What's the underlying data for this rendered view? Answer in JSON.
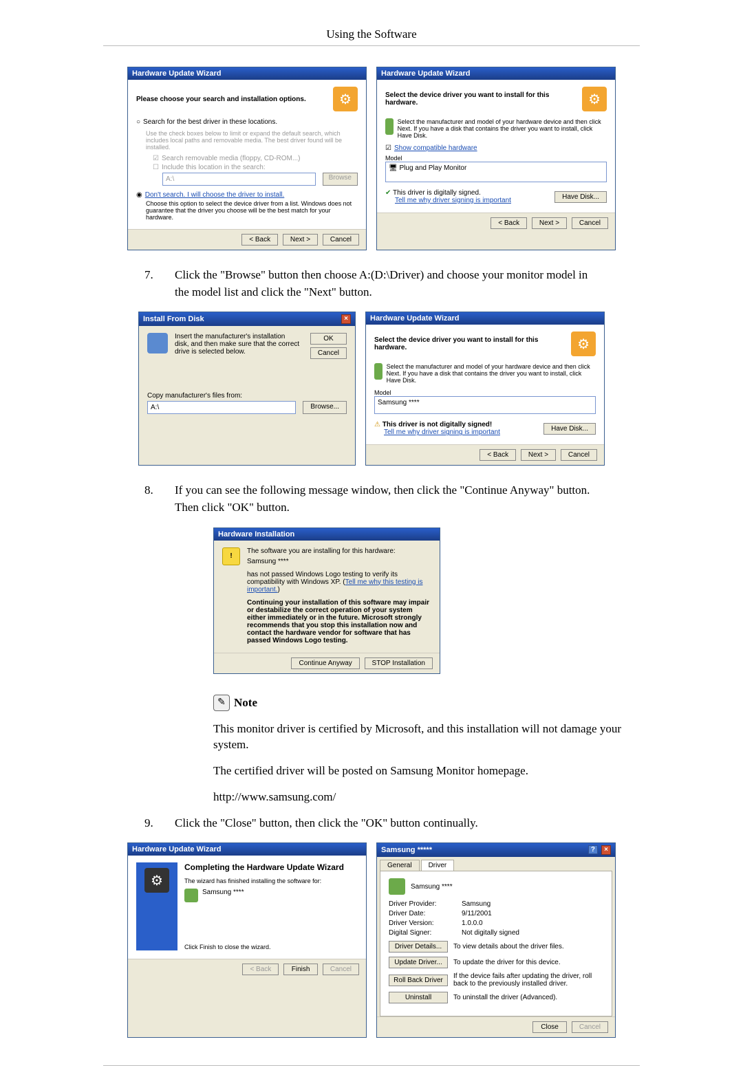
{
  "page_header": "Using the Software",
  "steps": {
    "s7_num": "7.",
    "s7_text": "Click the \"Browse\" button then choose A:(D:\\Driver) and choose your monitor model in the model list and click the \"Next\" button.",
    "s8_num": "8.",
    "s8_text": "If you can see the following message window, then click the \"Continue Anyway\" button. Then click \"OK\" button.",
    "s9_num": "9.",
    "s9_text": "Click the \"Close\" button, then click the \"OK\" button continually."
  },
  "note": {
    "label": "Note",
    "p1": "This monitor driver is certified by Microsoft, and this installation will not damage your system.",
    "p2": "The certified driver will be posted on Samsung Monitor homepage.",
    "p3": "http://www.samsung.com/"
  },
  "dlg_wiz1": {
    "title": "Hardware Update Wizard",
    "head": "Please choose your search and installation options.",
    "r1": "Search for the best driver in these locations.",
    "r1_desc": "Use the check boxes below to limit or expand the default search, which includes local paths and removable media. The best driver found will be installed.",
    "c1": "Search removable media (floppy, CD-ROM...)",
    "c2": "Include this location in the search:",
    "path": "A:\\",
    "browse": "Browse",
    "r2": "Don't search. I will choose the driver to install.",
    "r2_desc": "Choose this option to select the device driver from a list. Windows does not guarantee that the driver you choose will be the best match for your hardware.",
    "back": "< Back",
    "next": "Next >",
    "cancel": "Cancel"
  },
  "dlg_wiz2": {
    "title": "Hardware Update Wizard",
    "head": "Select the device driver you want to install for this hardware.",
    "desc": "Select the manufacturer and model of your hardware device and then click Next. If you have a disk that contains the driver you want to install, click Have Disk.",
    "show_compat": "Show compatible hardware",
    "model_lbl": "Model",
    "model_item": "Plug and Play Monitor",
    "signed": "This driver is digitally signed.",
    "tell": "Tell me why driver signing is important",
    "have_disk": "Have Disk...",
    "back": "< Back",
    "next": "Next >",
    "cancel": "Cancel"
  },
  "dlg_install": {
    "title": "Install From Disk",
    "desc": "Insert the manufacturer's installation disk, and then make sure that the correct drive is selected below.",
    "ok": "OK",
    "cancel": "Cancel",
    "copy_lbl": "Copy manufacturer's files from:",
    "path": "A:\\",
    "browse": "Browse..."
  },
  "dlg_wiz3": {
    "title": "Hardware Update Wizard",
    "head": "Select the device driver you want to install for this hardware.",
    "desc": "Select the manufacturer and model of your hardware device and then click Next. If you have a disk that contains the driver you want to install, click Have Disk.",
    "model_lbl": "Model",
    "model_item": "Samsung ****",
    "unsigned": "This driver is not digitally signed!",
    "tell": "Tell me why driver signing is important",
    "have_disk": "Have Disk...",
    "back": "< Back",
    "next": "Next >",
    "cancel": "Cancel"
  },
  "dlg_hwinst": {
    "title": "Hardware Installation",
    "intro": "The software you are installing for this hardware:",
    "device": "Samsung ****",
    "p1a": "has not passed Windows Logo testing to verify its compatibility with Windows XP. (",
    "p1b": "Tell me why this testing is important.",
    "p1c": ")",
    "warn": "Continuing your installation of this software may impair or destabilize the correct operation of your system either immediately or in the future. Microsoft strongly recommends that you stop this installation now and contact the hardware vendor for software that has passed Windows Logo testing.",
    "cont": "Continue Anyway",
    "stop": "STOP Installation"
  },
  "dlg_wiz4": {
    "title": "Hardware Update Wizard",
    "head": "Completing the Hardware Update Wizard",
    "desc": "The wizard has finished installing the software for:",
    "device": "Samsung ****",
    "close_hint": "Click Finish to close the wizard.",
    "back": "< Back",
    "finish": "Finish",
    "cancel": "Cancel"
  },
  "dlg_props": {
    "title": "Samsung *****",
    "tab_general": "General",
    "tab_driver": "Driver",
    "device": "Samsung ****",
    "rows": {
      "prov_lbl": "Driver Provider:",
      "prov_val": "Samsung",
      "date_lbl": "Driver Date:",
      "date_val": "9/11/2001",
      "ver_lbl": "Driver Version:",
      "ver_val": "1.0.0.0",
      "sign_lbl": "Digital Signer:",
      "sign_val": "Not digitally signed"
    },
    "btns": {
      "details": "Driver Details...",
      "details_d": "To view details about the driver files.",
      "update": "Update Driver...",
      "update_d": "To update the driver for this device.",
      "rollback": "Roll Back Driver",
      "rollback_d": "If the device fails after updating the driver, roll back to the previously installed driver.",
      "uninstall": "Uninstall",
      "uninstall_d": "To uninstall the driver (Advanced)."
    },
    "close": "Close",
    "cancel": "Cancel"
  }
}
